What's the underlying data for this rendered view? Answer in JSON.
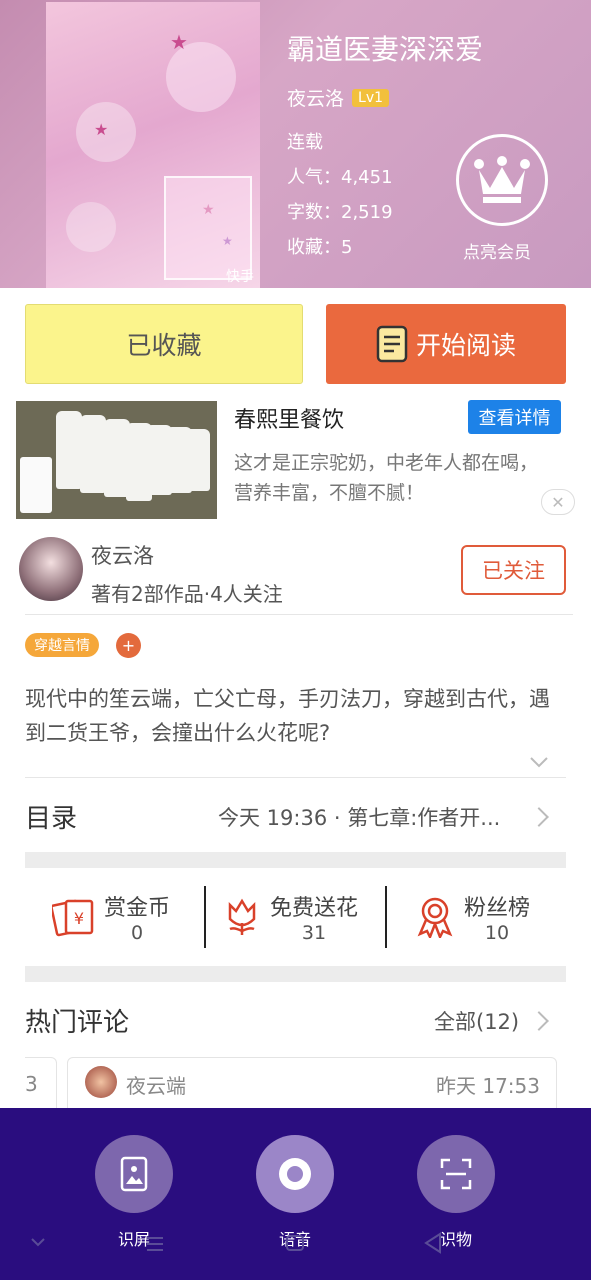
{
  "book": {
    "title": "霸道医妻深深爱",
    "author": "夜云洛",
    "level": "Lv1",
    "status": "连载",
    "popularity": "人气：4,451",
    "words": "字数：2,519",
    "favorites": "收藏：5",
    "vip_label": "点亮会员",
    "cover_brand": "快手"
  },
  "actions": {
    "favorite_label": "已收藏",
    "read_label": "开始阅读"
  },
  "ad": {
    "title": "春熙里餐饮",
    "cta": "查看详情",
    "description": "这才是正宗驼奶，中老年人都在喝，营养丰富，不膻不腻！",
    "close_glyph": "✕"
  },
  "author_block": {
    "name": "夜云洛",
    "summary": "著有2部作品·4人关注",
    "follow_label": "已关注"
  },
  "tags": {
    "items": [
      "穿越言情"
    ],
    "add_glyph": "+"
  },
  "intro": "现代中的笙云端，亡父亡母，手刃法刀，穿越到古代，遇到二货王爷，会撞出什么火花呢?",
  "toc": {
    "label": "目录",
    "latest": "今天 19:36 · 第七章:作者开..."
  },
  "stats": [
    {
      "label": "赏金币",
      "value": "0",
      "icon": "red-envelope-icon"
    },
    {
      "label": "免费送花",
      "value": "31",
      "icon": "flower-icon"
    },
    {
      "label": "粉丝榜",
      "value": "10",
      "icon": "award-ribbon-icon"
    }
  ],
  "comments": {
    "label": "热门评论",
    "all_label": "全部(12)",
    "prev_peek": "3",
    "first": {
      "user": "夜云端",
      "time": "昨天 17:53"
    }
  },
  "voice_bar": {
    "buttons": [
      {
        "label": "识屏",
        "icon": "screen-recognize-icon"
      },
      {
        "label": "语音",
        "icon": "voice-record-icon"
      },
      {
        "label": "识物",
        "icon": "object-scan-icon"
      }
    ]
  },
  "colors": {
    "accent_orange": "#ea693e",
    "favorite_yellow": "#fbf48c",
    "follow_red": "#e05b3a",
    "ad_blue": "#1d82e8",
    "tag_orange": "#f5a73a",
    "voice_bar_purple": "#2a0d7f"
  }
}
